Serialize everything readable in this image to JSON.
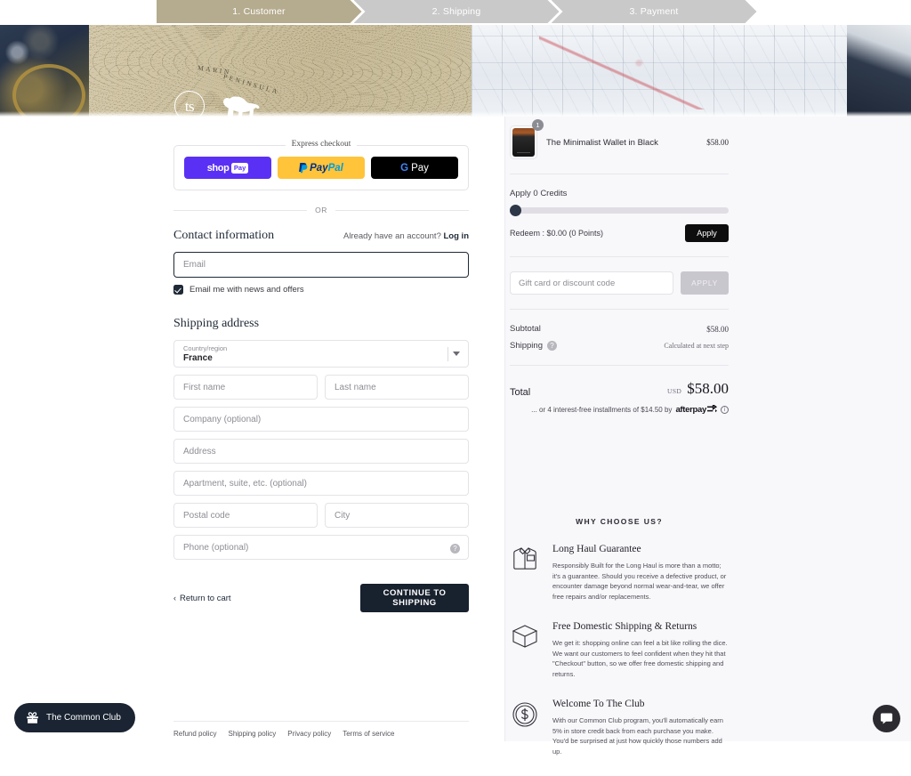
{
  "stepper": {
    "steps": [
      {
        "label": "1. Customer",
        "state": "active"
      },
      {
        "label": "2. Shipping",
        "state": "inactive"
      },
      {
        "label": "3. Payment",
        "state": "inactive"
      }
    ],
    "active_color": "#b5ab8e",
    "inactive_color": "#c9c9c9"
  },
  "banner": {
    "logo_mark": "ts",
    "map_label_1": "MARIN",
    "map_label_2": "PENINSULA"
  },
  "express": {
    "label": "Express checkout",
    "shop_pay": {
      "word": "shop",
      "tag": "Pay"
    },
    "paypal": {
      "part1": "Pay",
      "part2": "Pal"
    },
    "gpay": {
      "g": "G",
      "pay": "Pay"
    },
    "or": "OR"
  },
  "contact": {
    "title": "Contact information",
    "account_prompt": "Already have an account?",
    "login_label": "Log in",
    "email_placeholder": "Email",
    "email_value": "",
    "newsletter_label": "Email me with news and offers",
    "newsletter_checked": true
  },
  "shipping_address": {
    "title": "Shipping address",
    "country": {
      "label": "Country/region",
      "value": "France"
    },
    "first_name_placeholder": "First name",
    "last_name_placeholder": "Last name",
    "company_placeholder": "Company (optional)",
    "address_placeholder": "Address",
    "apartment_placeholder": "Apartment, suite, etc. (optional)",
    "postal_placeholder": "Postal code",
    "city_placeholder": "City",
    "phone_placeholder": "Phone (optional)",
    "help_glyph": "?"
  },
  "actions": {
    "return_to_cart": "Return to cart",
    "return_chevron": "‹",
    "continue_label": "CONTINUE TO SHIPPING"
  },
  "footer": {
    "links": [
      "Refund policy",
      "Shipping policy",
      "Privacy policy",
      "Terms of service"
    ]
  },
  "summary": {
    "product": {
      "name": "The Minimalist Wallet in Black",
      "price": "$58.00",
      "quantity": "1"
    },
    "credits": {
      "label": "Apply 0 Credits",
      "slider_value": 0,
      "redeem_text": "Redeem : $0.00 (0 Points)",
      "apply_label": "Apply"
    },
    "discount": {
      "placeholder": "Gift card or discount code",
      "value": "",
      "apply_label": "APPLY"
    },
    "lines": [
      {
        "key": "Subtotal",
        "value": "$58.00",
        "muted": false,
        "has_help": false
      },
      {
        "key": "Shipping",
        "value": "Calculated at next step",
        "muted": true,
        "has_help": true
      }
    ],
    "total": {
      "label": "Total",
      "currency": "USD",
      "amount": "$58.00"
    },
    "afterpay": {
      "text": "... or 4 interest-free installments of $14.50 by",
      "logo": "afterpay",
      "info_glyph": "i"
    }
  },
  "why_choose_us": {
    "title": "WHY CHOOSE US?",
    "items": [
      {
        "icon": "shirt-icon",
        "heading": "Long Haul Guarantee",
        "body": "Responsibly Built for the Long Haul is more than a motto; it's a guarantee. Should you receive a defective product, or encounter damage beyond normal wear-and-tear, we offer free repairs and/or replacements."
      },
      {
        "icon": "box-icon",
        "heading": "Free Domestic Shipping & Returns",
        "body": "We get it: shopping online can feel a bit like rolling the dice. We want our customers to feel confident when they hit that \"Checkout\" button, so we offer free domestic shipping and returns."
      },
      {
        "icon": "coin-icon",
        "heading": "Welcome To The Club",
        "body": "With our Common Club program, you'll automatically earn 5% in store credit back from each purchase you make. You'd be surprised at just how quickly those numbers add up."
      }
    ]
  },
  "widgets": {
    "club_label": "The Common Club",
    "chat_label": "chat"
  }
}
